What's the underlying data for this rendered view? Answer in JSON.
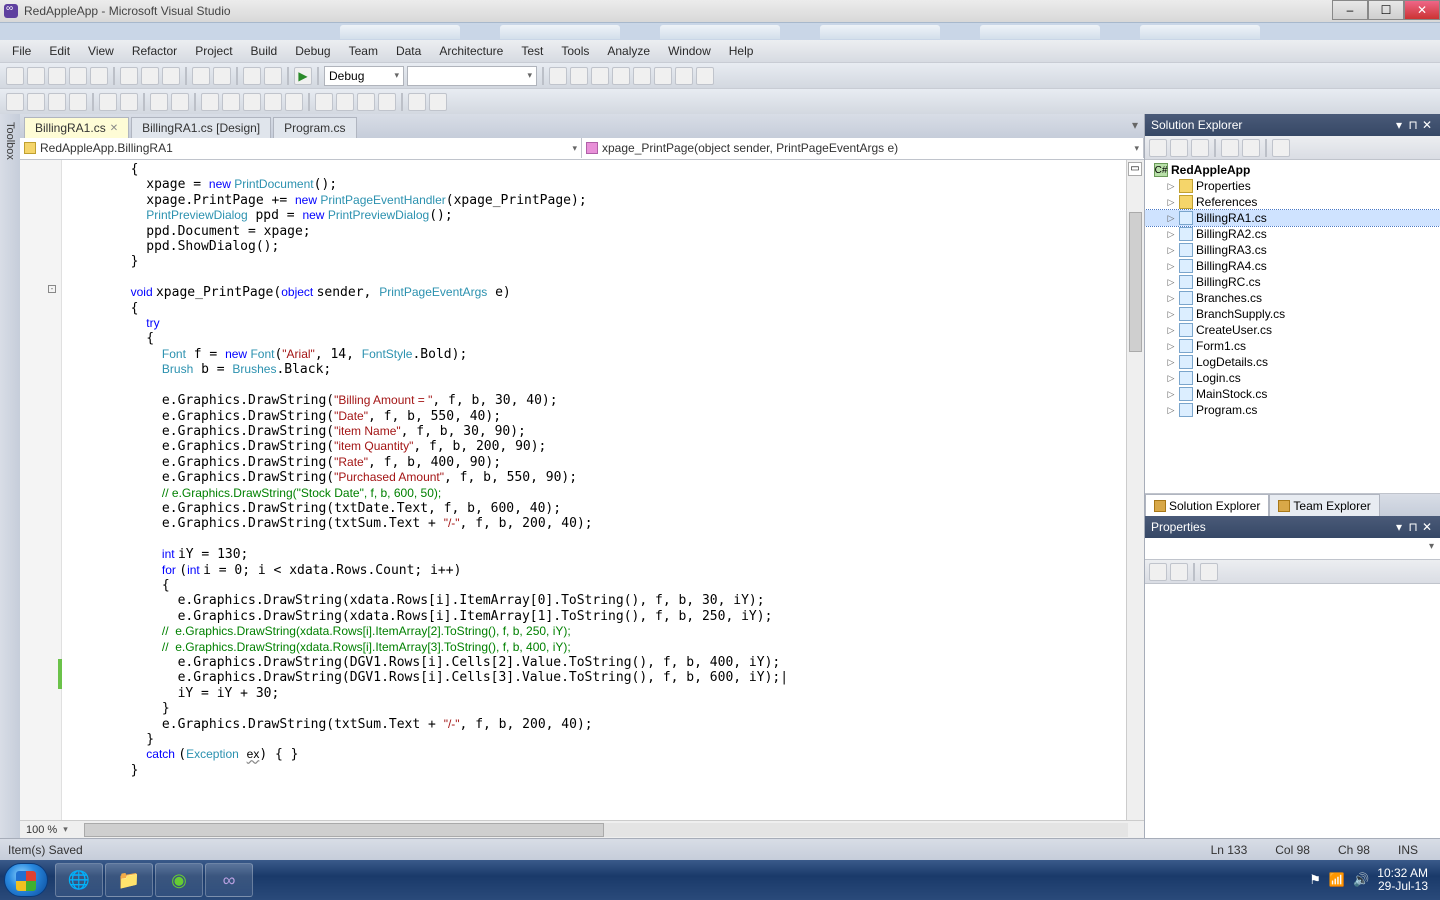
{
  "title": "RedAppleApp - Microsoft Visual Studio",
  "menu": [
    "File",
    "Edit",
    "View",
    "Refactor",
    "Project",
    "Build",
    "Debug",
    "Team",
    "Data",
    "Architecture",
    "Test",
    "Tools",
    "Analyze",
    "Window",
    "Help"
  ],
  "debug_config": "Debug",
  "toolbox_label": "Toolbox",
  "doc_tabs": [
    {
      "label": "BillingRA1.cs",
      "active": true,
      "closable": true
    },
    {
      "label": "BillingRA1.cs [Design]",
      "active": false,
      "closable": false
    },
    {
      "label": "Program.cs",
      "active": false,
      "closable": false
    }
  ],
  "nav_left": "RedAppleApp.BillingRA1",
  "nav_right": "xpage_PrintPage(object sender, PrintPageEventArgs e)",
  "code_lines": [
    {
      "i": 8,
      "t": "{"
    },
    {
      "i": 10,
      "t": "xpage = ",
      "k": "new ",
      "ty": "PrintDocument",
      "t2": "();"
    },
    {
      "i": 10,
      "t": "xpage.PrintPage += ",
      "k": "new ",
      "ty": "PrintPageEventHandler",
      "t2": "(xpage_PrintPage);"
    },
    {
      "i": 10,
      "ty": "PrintPreviewDialog",
      "t": " ppd = ",
      "k": "new ",
      "ty2": "PrintPreviewDialog",
      "t2": "();"
    },
    {
      "i": 10,
      "t": "ppd.Document = xpage;"
    },
    {
      "i": 10,
      "t": "ppd.ShowDialog();"
    },
    {
      "i": 8,
      "t": "}"
    },
    {
      "i": 0,
      "t": ""
    },
    {
      "i": 8,
      "k": "void ",
      "t": "xpage_PrintPage(",
      "k2": "object ",
      "t2": "sender, ",
      "ty": "PrintPageEventArgs",
      "t3": " e)"
    },
    {
      "i": 8,
      "t": "{"
    },
    {
      "i": 10,
      "k": "try"
    },
    {
      "i": 10,
      "t": "{"
    },
    {
      "i": 12,
      "ty": "Font",
      "t": " f = ",
      "k": "new ",
      "ty2": "Font",
      "t2": "(",
      "s": "\"Arial\"",
      "t3": ", 14, ",
      "ty3": "FontStyle",
      "t4": ".Bold);"
    },
    {
      "i": 12,
      "ty": "Brush",
      "t": " b = ",
      "ty2": "Brushes",
      "t2": ".Black;"
    },
    {
      "i": 0,
      "t": ""
    },
    {
      "i": 12,
      "t": "e.Graphics.DrawString(",
      "s": "\"Billing Amount = \"",
      "t2": ", f, b, 30, 40);"
    },
    {
      "i": 12,
      "t": "e.Graphics.DrawString(",
      "s": "\"Date\"",
      "t2": ", f, b, 550, 40);"
    },
    {
      "i": 12,
      "t": "e.Graphics.DrawString(",
      "s": "\"item Name\"",
      "t2": ", f, b, 30, 90);"
    },
    {
      "i": 12,
      "t": "e.Graphics.DrawString(",
      "s": "\"item Quantity\"",
      "t2": ", f, b, 200, 90);"
    },
    {
      "i": 12,
      "t": "e.Graphics.DrawString(",
      "s": "\"Rate\"",
      "t2": ", f, b, 400, 90);"
    },
    {
      "i": 12,
      "t": "e.Graphics.DrawString(",
      "s": "\"Purchased Amount\"",
      "t2": ", f, b, 550, 90);"
    },
    {
      "i": 12,
      "cm": "// e.Graphics.DrawString(\"Stock Date\", f, b, 600, 50);"
    },
    {
      "i": 12,
      "t": "e.Graphics.DrawString(txtDate.Text, f, b, 600, 40);"
    },
    {
      "i": 12,
      "t": "e.Graphics.DrawString(txtSum.Text + ",
      "s": "\"/-\"",
      "t2": ", f, b, 200, 40);"
    },
    {
      "i": 0,
      "t": ""
    },
    {
      "i": 12,
      "k": "int ",
      "t": "iY = 130;"
    },
    {
      "i": 12,
      "k": "for ",
      "t": "(",
      "k2": "int ",
      "t2": "i = 0; i < xdata.Rows.Count; i++)"
    },
    {
      "i": 12,
      "t": "{"
    },
    {
      "i": 14,
      "t": "e.Graphics.DrawString(xdata.Rows[i].ItemArray[0].ToString(), f, b, 30, iY);"
    },
    {
      "i": 14,
      "t": "e.Graphics.DrawString(xdata.Rows[i].ItemArray[1].ToString(), f, b, 250, iY);"
    },
    {
      "i": 12,
      "cm": "//  e.Graphics.DrawString(xdata.Rows[i].ItemArray[2].ToString(), f, b, 250, iY);"
    },
    {
      "i": 12,
      "cm": "//  e.Graphics.DrawString(xdata.Rows[i].ItemArray[3].ToString(), f, b, 400, iY);"
    },
    {
      "i": 14,
      "t": "e.Graphics.DrawString(DGV1.Rows[i].Cells[2].Value.ToString(), f, b, 400, iY);"
    },
    {
      "i": 14,
      "t": "e.Graphics.DrawString(DGV1.Rows[i].Cells[3].Value.ToString(), f, b, 600, iY);|"
    },
    {
      "i": 14,
      "t": "iY = iY + 30;"
    },
    {
      "i": 12,
      "t": "}"
    },
    {
      "i": 12,
      "t": "e.Graphics.DrawString(txtSum.Text + ",
      "s": "\"/-\"",
      "t2": ", f, b, 200, 40);"
    },
    {
      "i": 10,
      "t": "}"
    },
    {
      "i": 10,
      "k": "catch ",
      "t": "(",
      "ty": "Exception",
      "t2": " ",
      "u": "ex",
      "t3": ") { }"
    },
    {
      "i": 8,
      "t": "}"
    },
    {
      "i": 0,
      "t": ""
    }
  ],
  "zoom": "100 %",
  "solution_explorer": {
    "title": "Solution Explorer",
    "project": "RedAppleApp",
    "nodes": [
      {
        "type": "fold",
        "label": "Properties"
      },
      {
        "type": "fold",
        "label": "References"
      },
      {
        "type": "cs",
        "label": "BillingRA1.cs",
        "sel": true
      },
      {
        "type": "cs",
        "label": "BillingRA2.cs"
      },
      {
        "type": "cs",
        "label": "BillingRA3.cs"
      },
      {
        "type": "cs",
        "label": "BillingRA4.cs"
      },
      {
        "type": "cs",
        "label": "BillingRC.cs"
      },
      {
        "type": "cs",
        "label": "Branches.cs"
      },
      {
        "type": "cs",
        "label": "BranchSupply.cs"
      },
      {
        "type": "cs",
        "label": "CreateUser.cs"
      },
      {
        "type": "cs",
        "label": "Form1.cs"
      },
      {
        "type": "cs",
        "label": "LogDetails.cs"
      },
      {
        "type": "cs",
        "label": "Login.cs"
      },
      {
        "type": "cs",
        "label": "MainStock.cs"
      },
      {
        "type": "cs",
        "label": "Program.cs"
      }
    ],
    "tabs": [
      "Solution Explorer",
      "Team Explorer"
    ]
  },
  "properties_title": "Properties",
  "status": {
    "left": "Item(s) Saved",
    "ln": "Ln 133",
    "col": "Col 98",
    "ch": "Ch 98",
    "ins": "INS"
  },
  "clock": {
    "time": "10:32 AM",
    "date": "29-Jul-13"
  }
}
